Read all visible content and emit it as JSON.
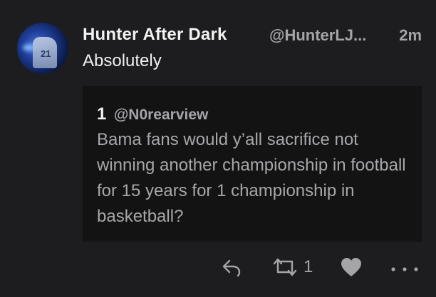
{
  "tweet": {
    "display_name": "Hunter After Dark",
    "handle": "@HunterLJ...",
    "time": "2m",
    "text": "Absolutely",
    "avatar_number": "21"
  },
  "quote": {
    "name": "1",
    "handle": "@N0rearview",
    "text": "Bama fans would y’all sacrifice not winning another championship in football for 15 years for 1 championship in basketball?"
  },
  "actions": {
    "reply_icon": "reply-icon",
    "retweet_icon": "retweet-icon",
    "retweet_count": "1",
    "like_icon": "heart-icon",
    "more_icon": "more-icon"
  },
  "colors": {
    "background": "#1d1d1f",
    "quote_background": "#131314",
    "primary_text": "#f0f0f0",
    "secondary_text": "#a5a5a8"
  }
}
